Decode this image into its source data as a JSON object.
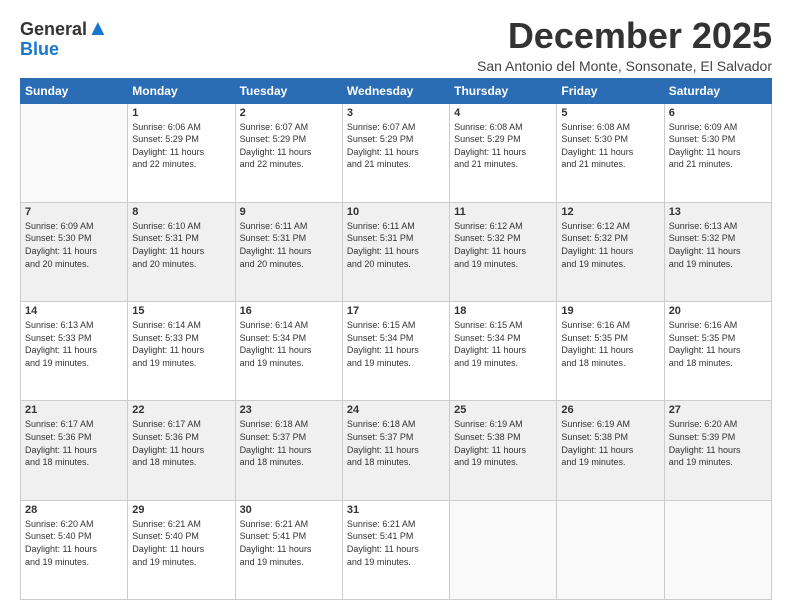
{
  "header": {
    "logo_general": "General",
    "logo_blue": "Blue",
    "month_title": "December 2025",
    "subtitle": "San Antonio del Monte, Sonsonate, El Salvador"
  },
  "weekdays": [
    "Sunday",
    "Monday",
    "Tuesday",
    "Wednesday",
    "Thursday",
    "Friday",
    "Saturday"
  ],
  "weeks": [
    [
      {
        "day": "",
        "sunrise": "",
        "sunset": "",
        "daylight": ""
      },
      {
        "day": "1",
        "sunrise": "6:06 AM",
        "sunset": "5:29 PM",
        "daylight": "11 hours and 22 minutes."
      },
      {
        "day": "2",
        "sunrise": "6:07 AM",
        "sunset": "5:29 PM",
        "daylight": "11 hours and 22 minutes."
      },
      {
        "day": "3",
        "sunrise": "6:07 AM",
        "sunset": "5:29 PM",
        "daylight": "11 hours and 21 minutes."
      },
      {
        "day": "4",
        "sunrise": "6:08 AM",
        "sunset": "5:29 PM",
        "daylight": "11 hours and 21 minutes."
      },
      {
        "day": "5",
        "sunrise": "6:08 AM",
        "sunset": "5:30 PM",
        "daylight": "11 hours and 21 minutes."
      },
      {
        "day": "6",
        "sunrise": "6:09 AM",
        "sunset": "5:30 PM",
        "daylight": "11 hours and 21 minutes."
      }
    ],
    [
      {
        "day": "7",
        "sunrise": "6:09 AM",
        "sunset": "5:30 PM",
        "daylight": "11 hours and 20 minutes."
      },
      {
        "day": "8",
        "sunrise": "6:10 AM",
        "sunset": "5:31 PM",
        "daylight": "11 hours and 20 minutes."
      },
      {
        "day": "9",
        "sunrise": "6:11 AM",
        "sunset": "5:31 PM",
        "daylight": "11 hours and 20 minutes."
      },
      {
        "day": "10",
        "sunrise": "6:11 AM",
        "sunset": "5:31 PM",
        "daylight": "11 hours and 20 minutes."
      },
      {
        "day": "11",
        "sunrise": "6:12 AM",
        "sunset": "5:32 PM",
        "daylight": "11 hours and 19 minutes."
      },
      {
        "day": "12",
        "sunrise": "6:12 AM",
        "sunset": "5:32 PM",
        "daylight": "11 hours and 19 minutes."
      },
      {
        "day": "13",
        "sunrise": "6:13 AM",
        "sunset": "5:32 PM",
        "daylight": "11 hours and 19 minutes."
      }
    ],
    [
      {
        "day": "14",
        "sunrise": "6:13 AM",
        "sunset": "5:33 PM",
        "daylight": "11 hours and 19 minutes."
      },
      {
        "day": "15",
        "sunrise": "6:14 AM",
        "sunset": "5:33 PM",
        "daylight": "11 hours and 19 minutes."
      },
      {
        "day": "16",
        "sunrise": "6:14 AM",
        "sunset": "5:34 PM",
        "daylight": "11 hours and 19 minutes."
      },
      {
        "day": "17",
        "sunrise": "6:15 AM",
        "sunset": "5:34 PM",
        "daylight": "11 hours and 19 minutes."
      },
      {
        "day": "18",
        "sunrise": "6:15 AM",
        "sunset": "5:34 PM",
        "daylight": "11 hours and 19 minutes."
      },
      {
        "day": "19",
        "sunrise": "6:16 AM",
        "sunset": "5:35 PM",
        "daylight": "11 hours and 18 minutes."
      },
      {
        "day": "20",
        "sunrise": "6:16 AM",
        "sunset": "5:35 PM",
        "daylight": "11 hours and 18 minutes."
      }
    ],
    [
      {
        "day": "21",
        "sunrise": "6:17 AM",
        "sunset": "5:36 PM",
        "daylight": "11 hours and 18 minutes."
      },
      {
        "day": "22",
        "sunrise": "6:17 AM",
        "sunset": "5:36 PM",
        "daylight": "11 hours and 18 minutes."
      },
      {
        "day": "23",
        "sunrise": "6:18 AM",
        "sunset": "5:37 PM",
        "daylight": "11 hours and 18 minutes."
      },
      {
        "day": "24",
        "sunrise": "6:18 AM",
        "sunset": "5:37 PM",
        "daylight": "11 hours and 18 minutes."
      },
      {
        "day": "25",
        "sunrise": "6:19 AM",
        "sunset": "5:38 PM",
        "daylight": "11 hours and 19 minutes."
      },
      {
        "day": "26",
        "sunrise": "6:19 AM",
        "sunset": "5:38 PM",
        "daylight": "11 hours and 19 minutes."
      },
      {
        "day": "27",
        "sunrise": "6:20 AM",
        "sunset": "5:39 PM",
        "daylight": "11 hours and 19 minutes."
      }
    ],
    [
      {
        "day": "28",
        "sunrise": "6:20 AM",
        "sunset": "5:40 PM",
        "daylight": "11 hours and 19 minutes."
      },
      {
        "day": "29",
        "sunrise": "6:21 AM",
        "sunset": "5:40 PM",
        "daylight": "11 hours and 19 minutes."
      },
      {
        "day": "30",
        "sunrise": "6:21 AM",
        "sunset": "5:41 PM",
        "daylight": "11 hours and 19 minutes."
      },
      {
        "day": "31",
        "sunrise": "6:21 AM",
        "sunset": "5:41 PM",
        "daylight": "11 hours and 19 minutes."
      },
      {
        "day": "",
        "sunrise": "",
        "sunset": "",
        "daylight": ""
      },
      {
        "day": "",
        "sunrise": "",
        "sunset": "",
        "daylight": ""
      },
      {
        "day": "",
        "sunrise": "",
        "sunset": "",
        "daylight": ""
      }
    ]
  ]
}
